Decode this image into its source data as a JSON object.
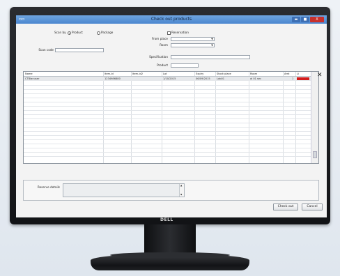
{
  "window": {
    "title": "Check out products",
    "sys_icon": "▫▫",
    "btn_min": "▬",
    "btn_max": "■",
    "btn_close": "X"
  },
  "form": {
    "scan_by_label": "Scan by",
    "radio_product_label": "Product",
    "radio_package_label": "Package",
    "reservation_label": "Reservation",
    "scan_code_label": "Scan code",
    "scan_code_value": "",
    "from_place_label": "From place",
    "from_place_value": "",
    "room_label": "Room",
    "room_value": "",
    "specification_label": "Specification",
    "specification_value": "",
    "product_label": "Product",
    "product_value": ""
  },
  "grid": {
    "columns": [
      "Name",
      "Item-id",
      "Item-id2",
      "Lot",
      "Expiry",
      "Stock place",
      "Room",
      "Amt",
      "Li"
    ],
    "rows": [
      {
        "name": "CTBlanuser",
        "item_id": "1234986880",
        "item_id2": "",
        "lot": "1/10/2015",
        "expiry": "06/09/2015",
        "stock_place": "Lab01",
        "room": "al 01 sec",
        "amt": "1",
        "li": ""
      }
    ],
    "close_icon": "✕"
  },
  "notes": {
    "label": "Reserve details",
    "value": "",
    "scroll_up": "▲",
    "scroll_down": "▼"
  },
  "buttons": {
    "check_out": "Check out",
    "cancel": "Cancel"
  },
  "monitor": {
    "brand": "DELL"
  },
  "colors": {
    "titlebar": "#4a86cf",
    "close": "#c9302c",
    "flag": "#d31c1c"
  }
}
